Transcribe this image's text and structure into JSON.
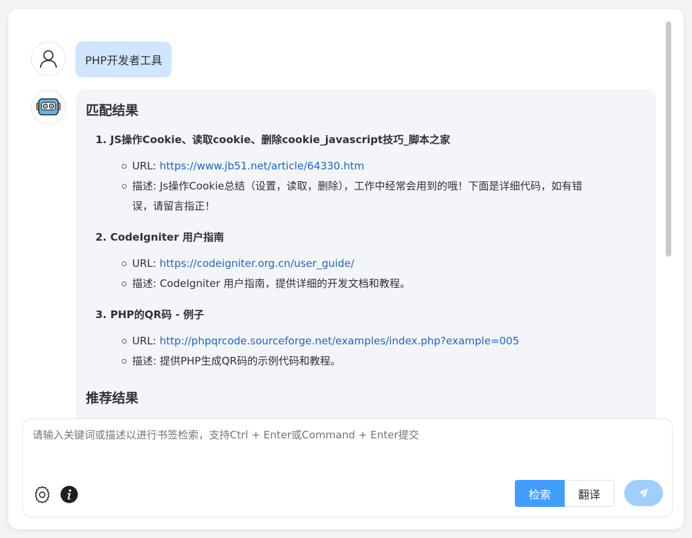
{
  "user_message": "PHP开发者工具",
  "match_section_title": "匹配结果",
  "recommend_section_title": "推荐结果",
  "url_label": "URL: ",
  "desc_label": "描述: ",
  "results": [
    {
      "number": "1.",
      "title": "JS操作Cookie、读取cookie、删除cookie_javascript技巧_脚本之家",
      "url": "https://www.jb51.net/article/64330.htm",
      "description_line1": "Js操作Cookie总结（设置，读取，删除），工作中经常会用到的哦！下面是详细代码，如有错",
      "description_line2": "误，请留言指正！"
    },
    {
      "number": "2.",
      "title": "CodeIgniter 用户指南",
      "url": "https://codeigniter.org.cn/user_guide/",
      "description_line1": "CodeIgniter 用户指南，提供详细的开发文档和教程。"
    },
    {
      "number": "3.",
      "title": "PHP的QR码 - 例子",
      "url": "http://phpqrcode.sourceforge.net/examples/index.php?example=005",
      "description_line1": "提供PHP生成QR码的示例代码和教程。"
    }
  ],
  "input": {
    "placeholder": "请输入关键词或描述以进行书签检索，支持Ctrl + Enter或Command + Enter提交"
  },
  "buttons": {
    "search": "检索",
    "translate": "翻译"
  },
  "icons": {
    "user_avatar": "user-icon",
    "bot_avatar": "robot-icon",
    "settings": "gear-icon",
    "info": "info-icon",
    "send": "send-icon"
  },
  "colors": {
    "accent": "#409eff",
    "user_bubble": "#d0e6ff",
    "link": "#1a66c9",
    "send_disabled": "#a0cfff"
  }
}
